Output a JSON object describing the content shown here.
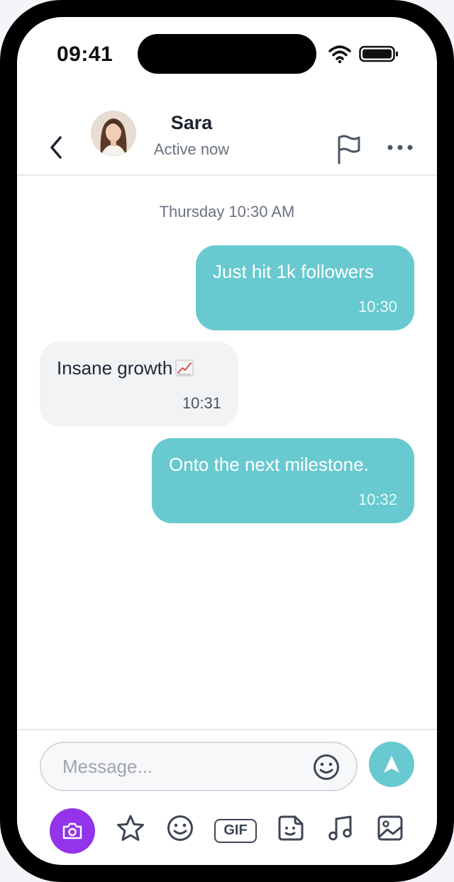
{
  "status_bar": {
    "time": "09:41"
  },
  "header": {
    "contact_name": "Sara",
    "contact_status": "Active now"
  },
  "conversation": {
    "day_label": "Thursday 10:30 AM",
    "messages": [
      {
        "direction": "outgoing",
        "text": "Just hit 1k followers",
        "time": "10:30"
      },
      {
        "direction": "incoming",
        "text": "Insane growth",
        "emoji": "chart-increasing-icon",
        "time": "10:31"
      },
      {
        "direction": "outgoing",
        "text": "Onto the next milestone.",
        "time": "10:32"
      }
    ]
  },
  "composer": {
    "placeholder": "Message...",
    "value": "",
    "toolbar": [
      "camera-icon",
      "star-icon",
      "emoji-icon",
      "gif-button",
      "sticker-icon",
      "music-icon",
      "image-icon"
    ],
    "gif_label": "GIF"
  },
  "colors": {
    "outgoing_bubble": "#68c9d0",
    "incoming_bubble": "#f2f3f5",
    "camera_button": "#9333ea",
    "send_button": "#68c9d0"
  }
}
